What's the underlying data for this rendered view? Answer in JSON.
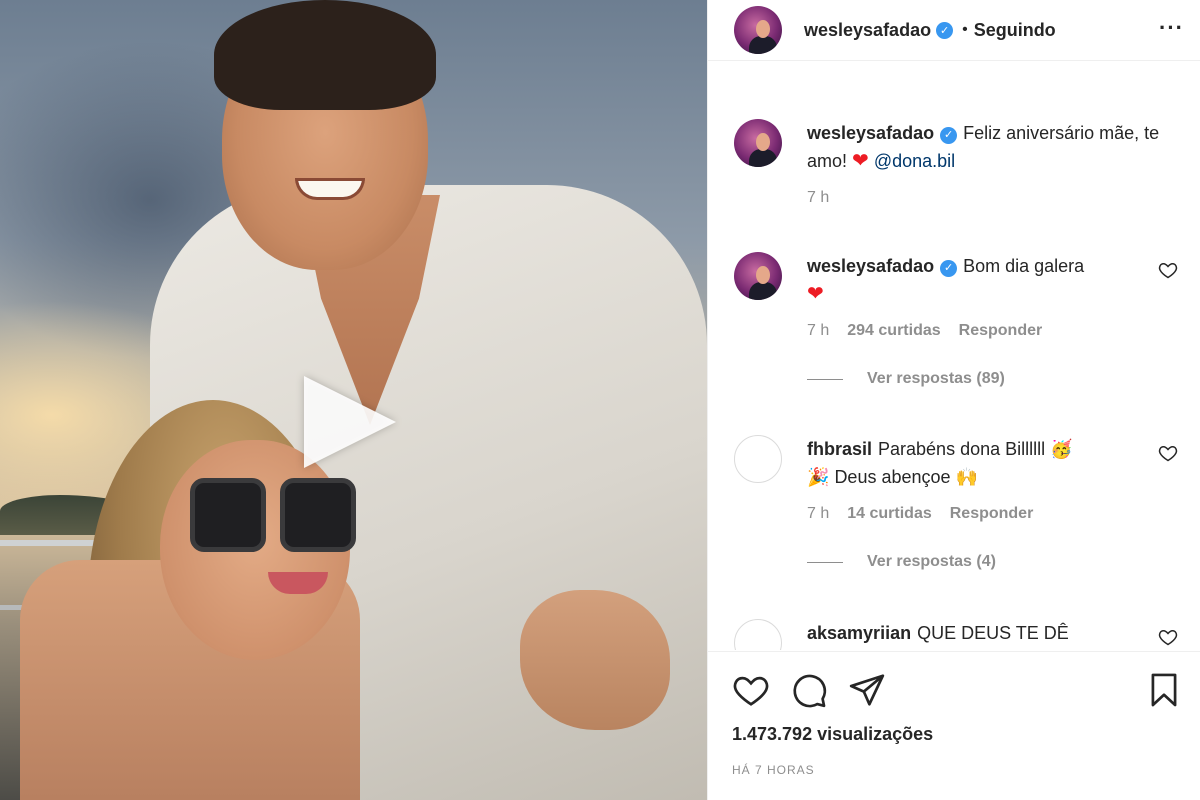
{
  "post": {
    "author": "wesleysafadao",
    "follow_status": "Seguindo",
    "separator": "•",
    "more_icon": "more-horizontal-icon"
  },
  "comments": [
    {
      "username": "wesleysafadao",
      "text": "Feliz aniversário mãe, te amo!",
      "emoji": "❤",
      "mention": "@dona.bil",
      "time": "7 h"
    },
    {
      "username": "wesleysafadao",
      "text": "Bom dia galera",
      "emoji": "❤",
      "time": "7 h",
      "likes": "294 curtidas",
      "reply": "Responder",
      "view_replies": "Ver respostas (89)"
    },
    {
      "username": "fhbrasil",
      "text": "Parabéns dona Billllll",
      "emoji1": "🥳",
      "emoji2": "🎉",
      "text2": "Deus abençoe",
      "emoji3": "🙌",
      "time": "7 h",
      "likes": "14 curtidas",
      "reply": "Responder",
      "view_replies": "Ver respostas (4)"
    },
    {
      "username": "aksamyriian",
      "text": "QUE DEUS TE DÊ"
    }
  ],
  "footer": {
    "views": "1.473.792 visualizações",
    "posted": "HÁ 7 HORAS"
  },
  "colors": {
    "verified": "#3897f0",
    "muted": "#8e8e8e",
    "mention": "#00376b",
    "heart": "#ed1c24"
  }
}
